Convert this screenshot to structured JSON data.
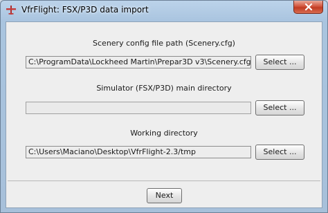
{
  "window": {
    "title": "VfrFlight: FSX/P3D data import"
  },
  "form": {
    "sections": [
      {
        "label": "Scenery config file path (Scenery.cfg)",
        "value": "C:\\ProgramData\\Lockheed Martin\\Prepar3D v3\\Scenery.cfg",
        "button": "Select ..."
      },
      {
        "label": "Simulator (FSX/P3D) main directory",
        "value": "",
        "button": "Select ..."
      },
      {
        "label": "Working directory",
        "value": "C:\\Users\\Maciano\\Desktop\\VfrFlight-2.3/tmp",
        "button": "Select ..."
      }
    ]
  },
  "footer": {
    "next_label": "Next"
  },
  "colors": {
    "titlebar": "#a9c4df",
    "close_button": "#c13b22",
    "client_background": "#eeeeee",
    "app_icon": "#b02a2a"
  },
  "icons": {
    "app": "airplane-icon",
    "close": "close-icon"
  }
}
